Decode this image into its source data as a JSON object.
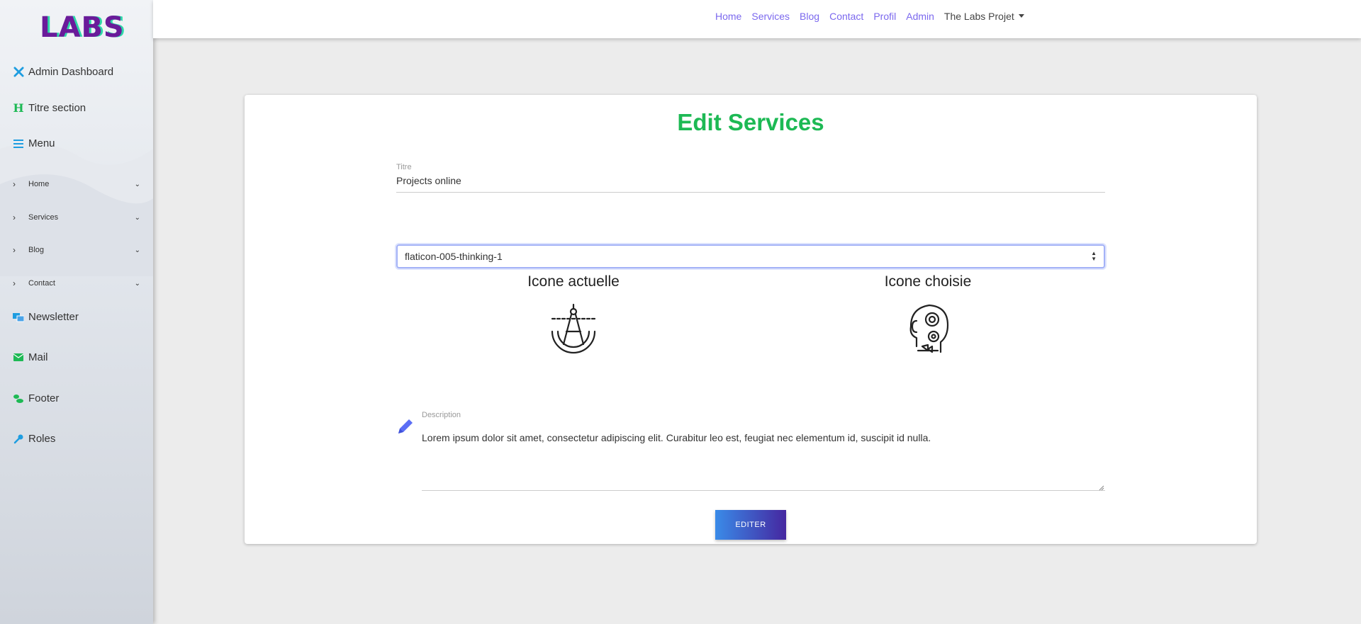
{
  "logo": "LABS",
  "sidebar": {
    "top_items": [
      {
        "label": "Admin Dashboard",
        "icon": "tools-icon"
      },
      {
        "label": "Titre section",
        "icon": "heading-icon"
      },
      {
        "label": "Menu",
        "icon": "menu-icon"
      }
    ],
    "sub_items": [
      {
        "label": "Home"
      },
      {
        "label": "Services"
      },
      {
        "label": "Blog"
      },
      {
        "label": "Contact"
      }
    ],
    "bottom_items": [
      {
        "label": "Newsletter",
        "icon": "newsletter-icon"
      },
      {
        "label": "Mail",
        "icon": "mail-icon"
      },
      {
        "label": "Footer",
        "icon": "footer-icon"
      },
      {
        "label": "Roles",
        "icon": "key-icon"
      }
    ]
  },
  "topnav": {
    "links": [
      "Home",
      "Services",
      "Blog",
      "Contact",
      "Profil",
      "Admin"
    ],
    "dropdown": "The Labs Projet"
  },
  "form": {
    "title": "Edit Services",
    "titre_label": "Titre",
    "titre_value": "Projects online",
    "select_value": "flaticon-005-thinking-1",
    "icon_current_label": "Icone actuelle",
    "icon_chosen_label": "Icone choisie",
    "description_label": "Description",
    "description_value": "Lorem ipsum dolor sit amet, consectetur adipiscing elit. Curabitur leo est, feugiat nec elementum id, suscipit id nulla.",
    "submit_label": "EDITER"
  },
  "colors": {
    "title": "#1db954",
    "nav_link": "#7b68ee",
    "button_start": "#3a8be8",
    "button_end": "#4527a0"
  }
}
